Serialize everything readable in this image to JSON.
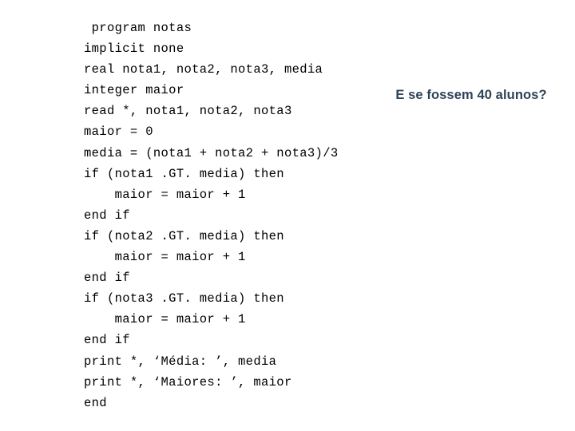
{
  "slide": {
    "background_color": "#ffffff",
    "code": {
      "language": "fortran",
      "text_color": "#000000",
      "lines": [
        " program notas",
        "implicit none",
        "real nota1, nota2, nota3, media",
        "integer maior",
        "read *, nota1, nota2, nota3",
        "maior = 0",
        "media = (nota1 + nota2 + nota3)/3",
        "if (nota1 .GT. media) then",
        "    maior = maior + 1",
        "end if",
        "if (nota2 .GT. media) then",
        "    maior = maior + 1",
        "end if",
        "if (nota3 .GT. media) then",
        "    maior = maior + 1",
        "end if",
        "print *, ‘Média: ’, media",
        "print *, ‘Maiores: ’, maior",
        "end"
      ]
    },
    "annotation": {
      "text": "E se fossem 40 alunos?",
      "color": "#2d4257"
    }
  }
}
